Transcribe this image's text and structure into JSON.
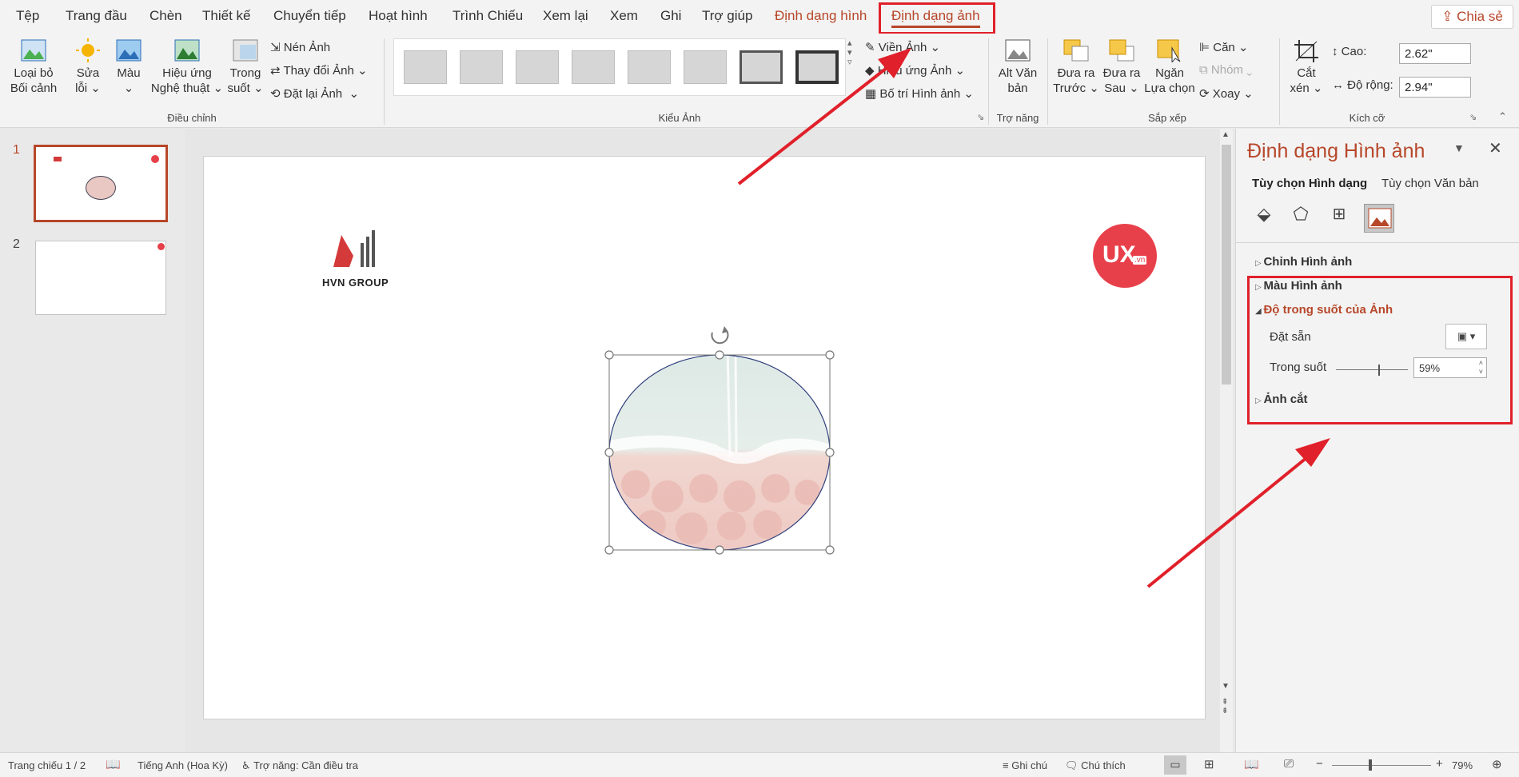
{
  "tabs": [
    {
      "label": "Tệp"
    },
    {
      "label": "Trang đầu"
    },
    {
      "label": "Chèn"
    },
    {
      "label": "Thiết kế"
    },
    {
      "label": "Chuyển tiếp"
    },
    {
      "label": "Hoạt hình"
    },
    {
      "label": "Trình Chiếu"
    },
    {
      "label": "Xem lại"
    },
    {
      "label": "Xem"
    },
    {
      "label": "Ghi"
    },
    {
      "label": "Trợ giúp"
    },
    {
      "label": "Định dạng hình"
    },
    {
      "label": "Định dạng ảnh"
    }
  ],
  "share_label": "Chia sẻ",
  "ribbon": {
    "remove_bg_1": "Loại bỏ",
    "remove_bg_2": "Bối cảnh",
    "corrections_1": "Sửa",
    "corrections_2": "lỗi",
    "color": "Màu",
    "artistic_1": "Hiệu ứng",
    "artistic_2": "Nghệ thuật",
    "transparency_1": "Trong",
    "transparency_2": "suốt",
    "compress": "Nén Ảnh",
    "change": "Thay đổi Ảnh",
    "reset": "Đặt lại Ảnh",
    "group_adjust": "Điều chỉnh",
    "border": "Viền Ảnh",
    "effects": "Hiệu ứng Ảnh",
    "layout": "Bố trí Hình ảnh",
    "group_styles": "Kiểu Ảnh",
    "alt_1": "Alt Văn",
    "alt_2": "bản",
    "group_access": "Trợ năng",
    "forward_1": "Đưa ra",
    "forward_2": "Trước",
    "backward_1": "Đưa ra",
    "backward_2": "Sau",
    "selpane_1": "Ngăn",
    "selpane_2": "Lựa chọn",
    "align": "Căn",
    "group": "Nhóm",
    "rotate": "Xoay",
    "group_arrange": "Sắp xếp",
    "crop_1": "Cắt",
    "crop_2": "xén",
    "height_label": "Cao:",
    "height_value": "2.62\"",
    "width_label": "Độ rộng:",
    "width_value": "2.94\"",
    "group_size": "Kích cỡ"
  },
  "thumbs": [
    {
      "num": "1"
    },
    {
      "num": "2"
    }
  ],
  "slide": {
    "logo_text": "HVN GROUP",
    "ux_text": "UX",
    "ux_sub": ".vn"
  },
  "panel": {
    "title": "Định dạng Hình ảnh",
    "tab_shape": "Tùy chọn Hình dạng",
    "tab_text": "Tùy chọn Văn bản",
    "sec_correct": "Chỉnh Hình ảnh",
    "sec_color": "Màu Hình ảnh",
    "sec_transparency": "Độ trong suốt của Ảnh",
    "preset_label": "Đặt sẵn",
    "transparency_label": "Trong suốt",
    "transparency_value": "59%",
    "transparency_level": 0.59,
    "sec_crop": "Ảnh cắt"
  },
  "status": {
    "slide_info": "Trang chiếu 1 / 2",
    "language": "Tiếng Anh (Hoa Kỳ)",
    "accessibility": "Trợ năng: Cần điều tra",
    "notes": "Ghi chú",
    "comments": "Chú thích",
    "zoom": "79%"
  },
  "colors": {
    "accent": "#b7472a",
    "annotation": "#e0202a"
  }
}
